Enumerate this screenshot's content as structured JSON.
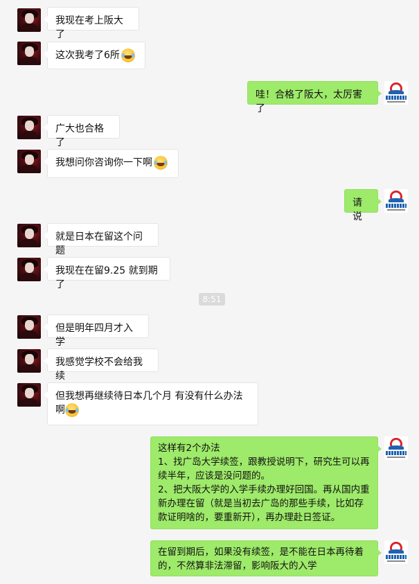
{
  "timestamp": "8:51",
  "messages": [
    {
      "side": "in",
      "text": "我现在考上阪大了",
      "emoji": false
    },
    {
      "side": "in",
      "text": "这次我考了6所",
      "emoji": true
    },
    {
      "side": "out",
      "text": "哇！合格了阪大，太厉害了",
      "emoji": false
    },
    {
      "side": "in",
      "text": "广大也合格了",
      "emoji": false
    },
    {
      "side": "in",
      "text": "我想问你咨询你一下啊",
      "emoji": true
    },
    {
      "side": "out",
      "text": "请说",
      "emoji": false
    },
    {
      "side": "in",
      "text": "就是日本在留这个问题",
      "emoji": false
    },
    {
      "side": "in",
      "text": "我现在在留9.25 就到期了",
      "emoji": false
    },
    {
      "side": "in",
      "text": "但是明年四月才入学",
      "emoji": false
    },
    {
      "side": "in",
      "text": "我感觉学校不会给我续",
      "emoji": false
    },
    {
      "side": "in",
      "text": "但我想再继续待日本几个月 有没有什么办法啊",
      "emoji": true
    },
    {
      "side": "out",
      "text": "这样有2个办法\n1、找广岛大学续签，跟教授说明下，研究生可以再续半年，应该是没问题的。\n2、把大阪大学的入学手续办理好回国。再从国内重新办理在留（就是当初去广岛的那些手续，比如存款证明啥的，要重新开），再办理赴日签证。",
      "emoji": false
    },
    {
      "side": "out",
      "text": "在留到期后，如果没有续签，是不能在日本再待着的，不然算非法滞留，影响阪大的入学",
      "emoji": false
    }
  ]
}
